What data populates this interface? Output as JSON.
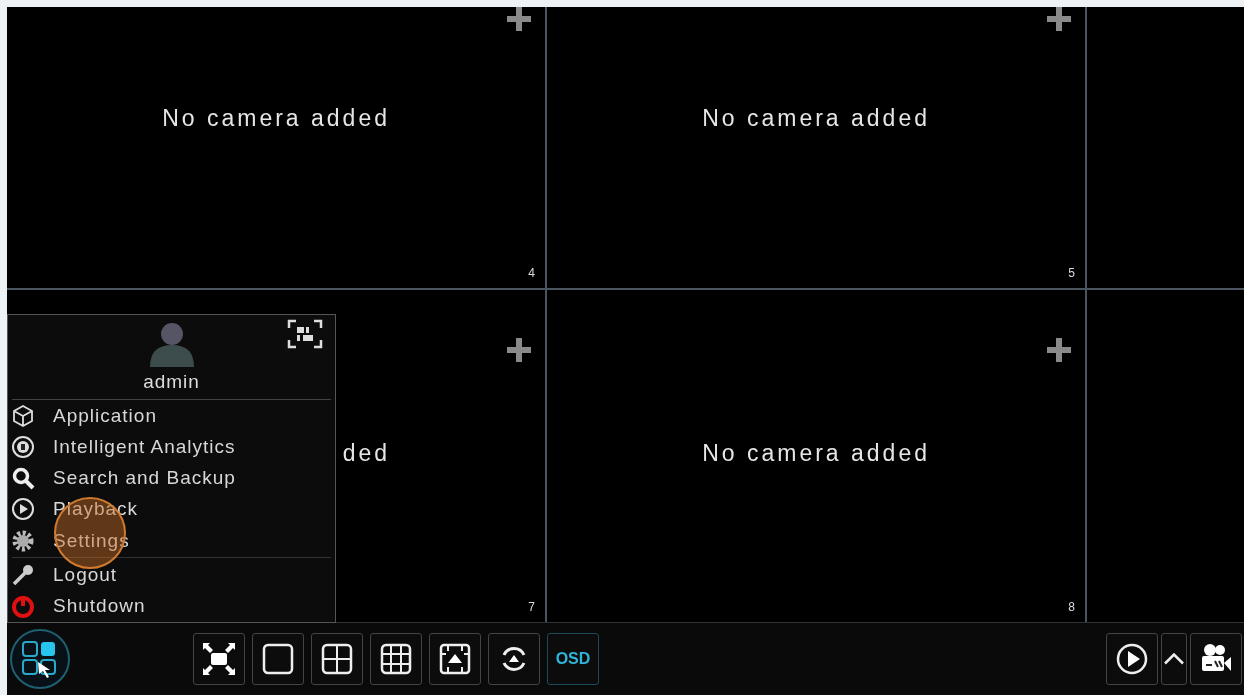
{
  "cells": [
    {
      "message": "No camera added",
      "number": "4"
    },
    {
      "message": "No camera added",
      "number": "5"
    },
    {
      "message": "ded",
      "number": "7"
    },
    {
      "message": "No camera added",
      "number": "8"
    }
  ],
  "menu": {
    "user": "admin",
    "sections": [
      {
        "items": [
          {
            "label": "Application"
          },
          {
            "label": "Intelligent Analytics"
          },
          {
            "label": "Search and Backup"
          },
          {
            "label": "Playback"
          },
          {
            "label": "Settings"
          }
        ]
      },
      {
        "items": [
          {
            "label": "Logout"
          },
          {
            "label": "Shutdown"
          }
        ]
      }
    ]
  },
  "toolbar": {
    "left": [
      {
        "kind": "fullscreen"
      },
      {
        "kind": "layout1"
      },
      {
        "kind": "layout4"
      },
      {
        "kind": "layout9"
      },
      {
        "kind": "custom"
      },
      {
        "kind": "sequence"
      },
      {
        "kind": "text",
        "label": "OSD"
      }
    ],
    "right": [
      {
        "kind": "playback"
      },
      {
        "kind": "caret"
      },
      {
        "kind": "record"
      }
    ]
  }
}
